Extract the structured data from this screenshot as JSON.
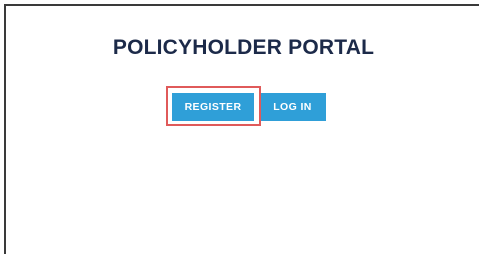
{
  "portal": {
    "title": "POLICYHOLDER PORTAL",
    "register_label": "REGISTER",
    "login_label": "LOG IN"
  },
  "colors": {
    "title": "#1c2a49",
    "button_bg": "#2f9fd8",
    "button_text": "#ffffff",
    "highlight_border": "#e05a5a",
    "frame_border": "#3a3a3a"
  }
}
